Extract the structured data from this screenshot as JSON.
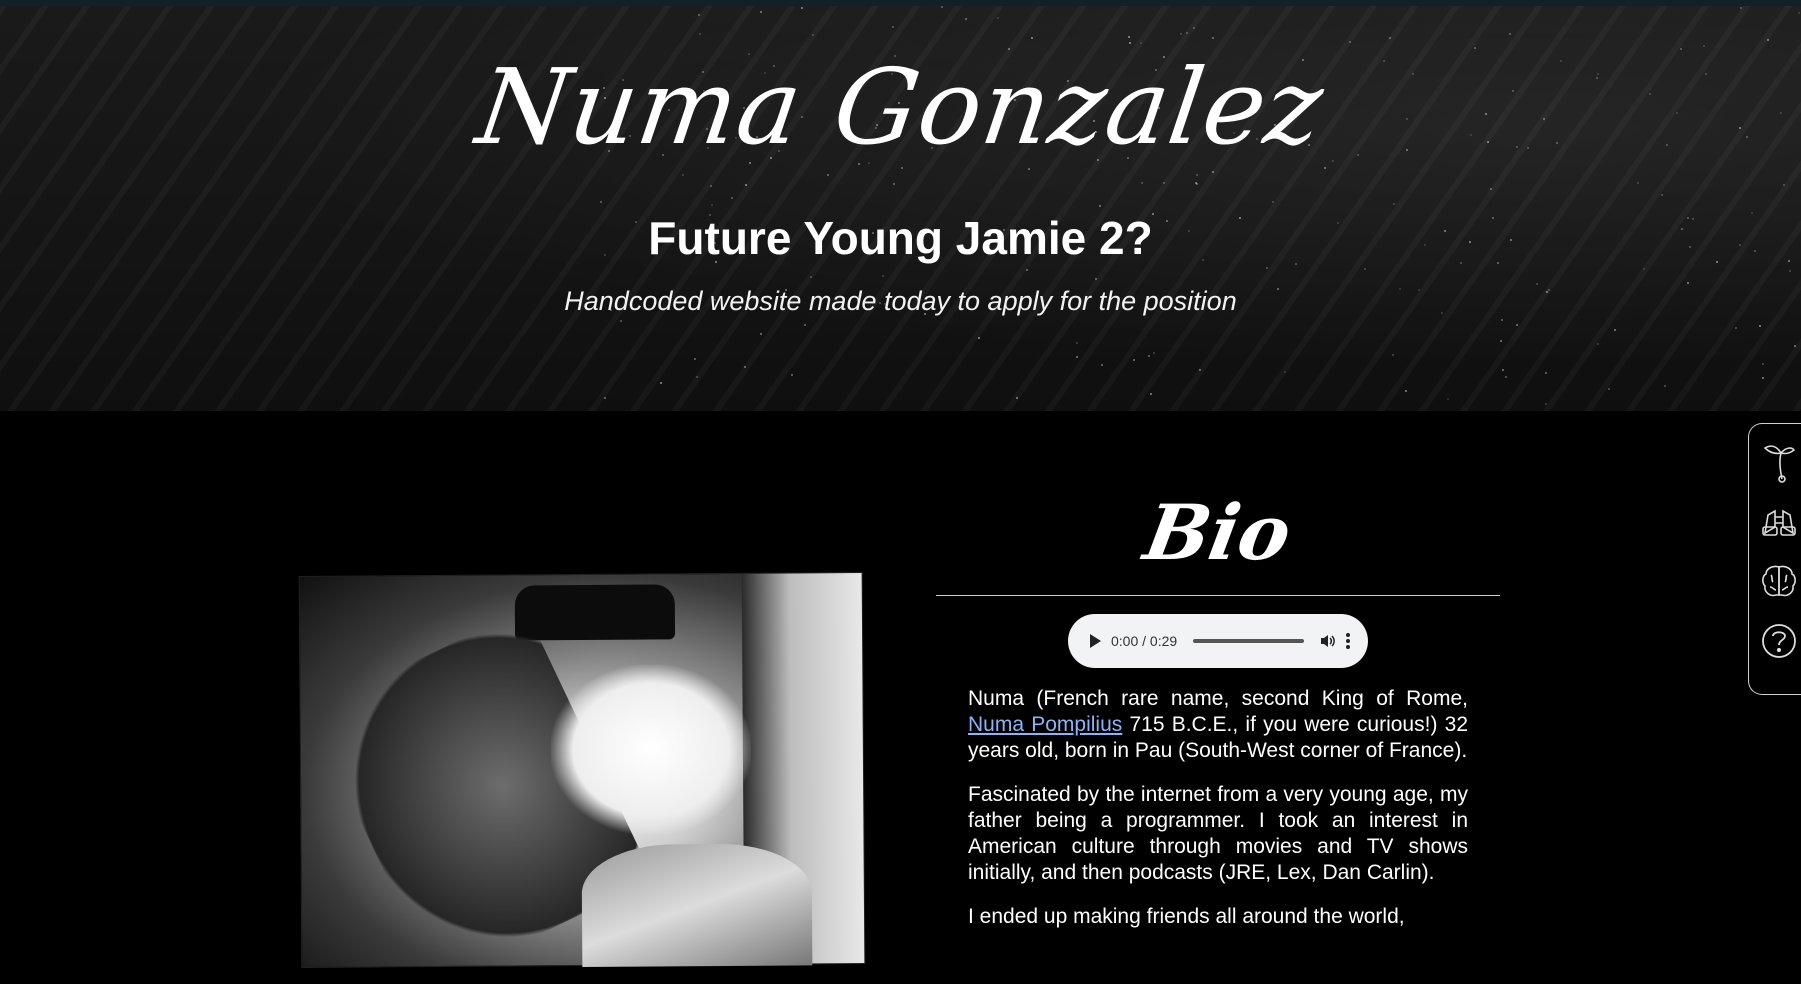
{
  "hero": {
    "title": "Numa Gonzalez",
    "subtitle": "Future Young Jamie 2?",
    "tagline": "Handcoded website made today to apply for the position"
  },
  "bio": {
    "heading": "Bio",
    "audio": {
      "time_display": "0:00 / 0:29",
      "progress": 0
    },
    "paragraphs": [
      {
        "before_link": "Numa (French rare name, second King of Rome, ",
        "link_text": "Numa Pompilius",
        "after_link": " 715 B.C.E., if you were curious!) 32 years old, born in Pau (South-West corner of France)."
      },
      {
        "text": "Fascinated by the internet from a very young age, my father being a programmer. I took an interest in American culture through movies and TV shows initially, and then podcasts (JRE, Lex, Dan Carlin)."
      },
      {
        "text": "I ended up making friends all around the world,"
      }
    ]
  },
  "side_nav": {
    "items": [
      {
        "icon": "sprout-icon"
      },
      {
        "icon": "binoculars-icon"
      },
      {
        "icon": "brain-icon"
      },
      {
        "icon": "question-icon"
      }
    ]
  },
  "colors": {
    "background": "#000000",
    "link": "#8ab4f8",
    "audio_bg": "#f1f3f4"
  }
}
